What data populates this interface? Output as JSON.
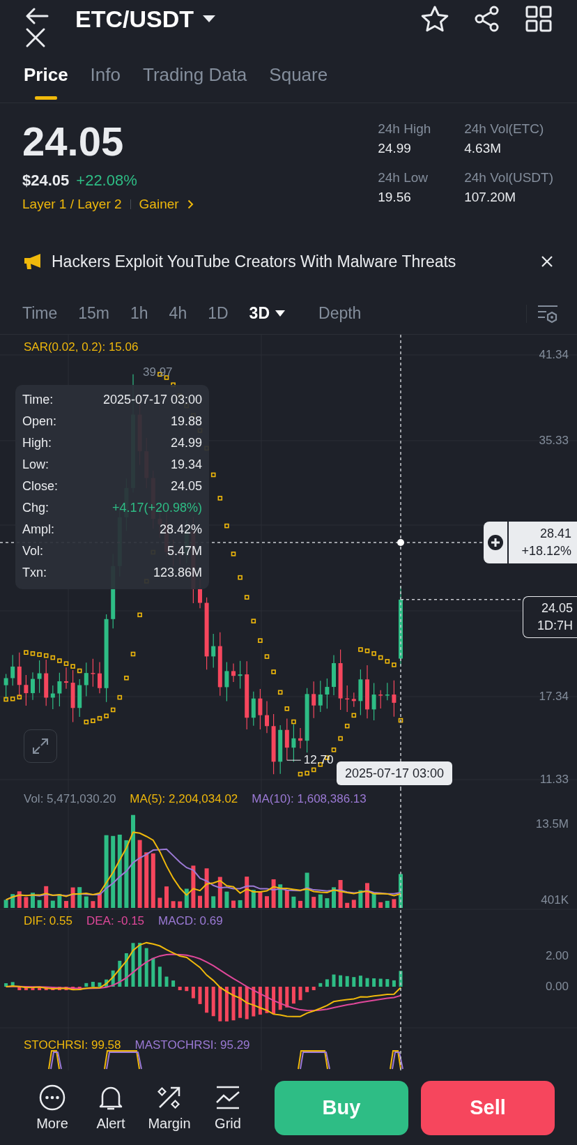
{
  "header": {
    "title": "ETC/USDT"
  },
  "tabs": [
    {
      "label": "Price",
      "selected": true
    },
    {
      "label": "Info",
      "selected": false
    },
    {
      "label": "Trading Data",
      "selected": false
    },
    {
      "label": "Square",
      "selected": false
    }
  ],
  "price": {
    "last": "24.05",
    "fiat": "$24.05",
    "change": "+22.08%",
    "tags": [
      {
        "label": "Layer 1 / Layer 2",
        "kind": "plain"
      },
      {
        "label": "Gainer",
        "kind": "link"
      }
    ]
  },
  "stats": [
    {
      "label": "24h High",
      "value": "24.99"
    },
    {
      "label": "24h Vol(ETC)",
      "value": "4.63M"
    },
    {
      "label": "24h Low",
      "value": "19.56"
    },
    {
      "label": "24h Vol(USDT)",
      "value": "107.20M"
    }
  ],
  "news": {
    "headline": "Hackers Exploit YouTube Creators With Malware Threats"
  },
  "intervals": [
    {
      "label": "Time",
      "selected": false,
      "kind": "plain"
    },
    {
      "label": "15m",
      "selected": false,
      "kind": "plain"
    },
    {
      "label": "1h",
      "selected": false,
      "kind": "plain"
    },
    {
      "label": "4h",
      "selected": false,
      "kind": "plain"
    },
    {
      "label": "1D",
      "selected": false,
      "kind": "plain"
    },
    {
      "label": "3D",
      "selected": true,
      "kind": "dropdown"
    },
    {
      "label": "Depth",
      "selected": false,
      "kind": "plain"
    }
  ],
  "main_chart": {
    "indicator": "SAR(0.02, 0.2): 15.06",
    "y_labels": [
      "41.34",
      "35.33",
      "17.34",
      "11.33"
    ],
    "high_mark": "39.97",
    "low_mark": "12.70",
    "tooltip": [
      {
        "label": "Time:",
        "value": "2025-07-17 03:00",
        "kind": "plain"
      },
      {
        "label": "Open:",
        "value": "19.88",
        "kind": "plain"
      },
      {
        "label": "High:",
        "value": "24.99",
        "kind": "plain"
      },
      {
        "label": "Low:",
        "value": "19.34",
        "kind": "plain"
      },
      {
        "label": "Close:",
        "value": "24.05",
        "kind": "plain"
      },
      {
        "label": "Chg:",
        "value": "+4.17(+20.98%)",
        "kind": "change"
      },
      {
        "label": "Ampl:",
        "value": "28.42%",
        "kind": "plain"
      },
      {
        "label": "Vol:",
        "value": "5.47M",
        "kind": "plain"
      },
      {
        "label": "Txn:",
        "value": "123.86M",
        "kind": "plain"
      }
    ],
    "crosshair": {
      "price": "28.41",
      "change": "+18.12%",
      "time": "2025-07-17 03:00"
    },
    "last_price_tag": {
      "price": "24.05",
      "countdown": "1D:7H"
    }
  },
  "volume": {
    "legend": [
      {
        "text": "Vol: 5,471,030.20",
        "color": "#848e9c"
      },
      {
        "text": "MA(5): 2,204,034.02",
        "color": "#f0b90b"
      },
      {
        "text": "MA(10): 1,608,386.13",
        "color": "#9c7ad6"
      }
    ],
    "y_labels": [
      "13.5M",
      "401K"
    ]
  },
  "macd": {
    "legend": [
      {
        "text": "DIF: 0.55",
        "color": "#f0b90b"
      },
      {
        "text": "DEA: -0.15",
        "color": "#e0489a"
      },
      {
        "text": "MACD: 0.69",
        "color": "#9c7ad6"
      }
    ],
    "y_labels": [
      "2.00",
      "0.00"
    ]
  },
  "stoch_rsi": {
    "legend": [
      {
        "text": "STOCHRSI: 99.58",
        "color": "#f0b90b"
      },
      {
        "text": "MASTOCHRSI: 95.29",
        "color": "#9c7ad6"
      }
    ]
  },
  "bottom_bar": {
    "actions": [
      {
        "label": "More",
        "kind": "more"
      },
      {
        "label": "Alert",
        "kind": "alert"
      },
      {
        "label": "Margin",
        "kind": "margin"
      },
      {
        "label": "Grid",
        "kind": "grid"
      }
    ],
    "buy": "Buy",
    "sell": "Sell"
  }
}
